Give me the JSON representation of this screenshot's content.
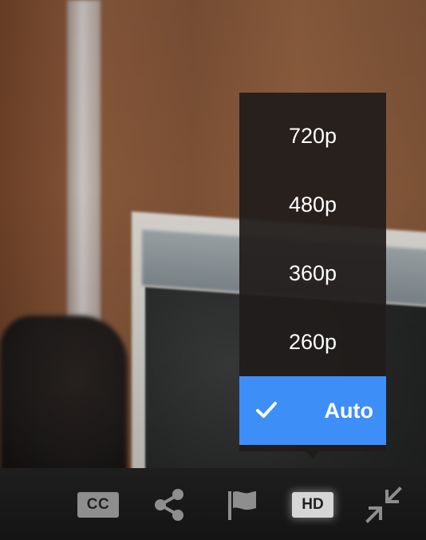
{
  "quality_menu": {
    "options": [
      {
        "label": "720p",
        "selected": false
      },
      {
        "label": "480p",
        "selected": false
      },
      {
        "label": "360p",
        "selected": false
      },
      {
        "label": "260p",
        "selected": false
      },
      {
        "label": "Auto",
        "selected": true
      }
    ],
    "selected_color": "#3e8ef7"
  },
  "controls": {
    "cc_label": "CC",
    "hd_label": "HD",
    "icons": [
      "closed-captions-icon",
      "share-icon",
      "flag-icon",
      "hd-icon",
      "exit-fullscreen-icon"
    ]
  }
}
